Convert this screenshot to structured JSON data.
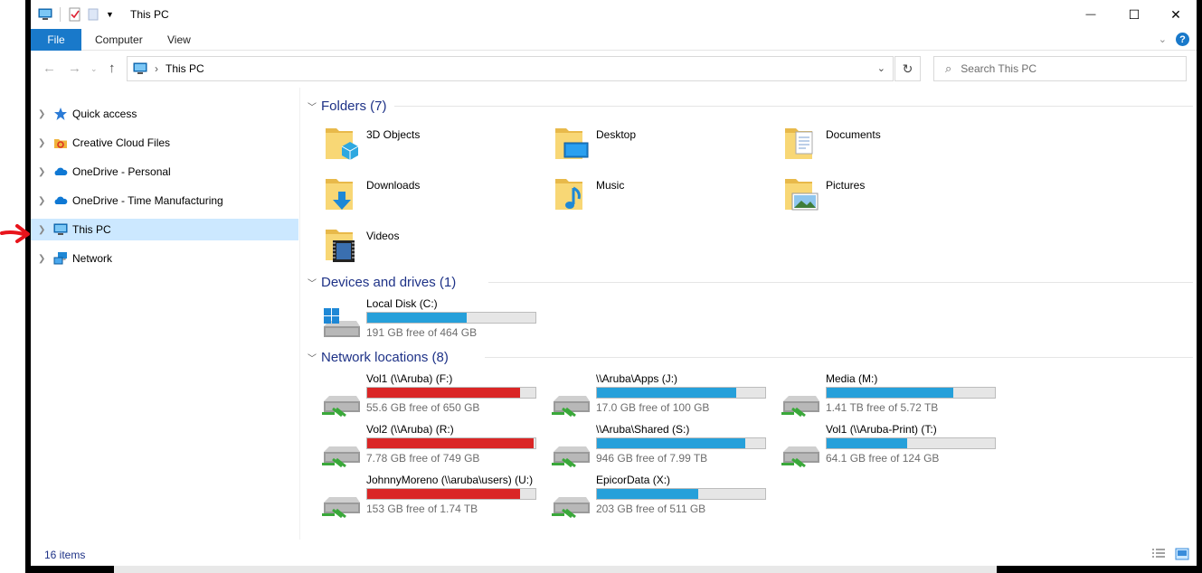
{
  "window": {
    "title": "This PC",
    "minimize": "—",
    "maximize": "☐",
    "close": "✕"
  },
  "ribbon": {
    "tabs": [
      {
        "label": "File"
      },
      {
        "label": "Computer"
      },
      {
        "label": "View"
      }
    ]
  },
  "address": {
    "breadcrumb": "This PC",
    "search_placeholder": "Search This PC"
  },
  "nav": {
    "items": [
      {
        "label": "Quick access",
        "icon": "star-icon"
      },
      {
        "label": "Creative Cloud Files",
        "icon": "creative-cloud-icon"
      },
      {
        "label": "OneDrive - Personal",
        "icon": "cloud-icon"
      },
      {
        "label": "OneDrive - Time Manufacturing",
        "icon": "cloud-icon"
      },
      {
        "label": "This PC",
        "icon": "computer-icon",
        "selected": true
      },
      {
        "label": "Network",
        "icon": "network-icon"
      }
    ]
  },
  "groups": {
    "folders": {
      "title": "Folders (7)",
      "items": [
        {
          "name": "3D Objects",
          "icon": "3d-objects-folder-icon"
        },
        {
          "name": "Desktop",
          "icon": "desktop-folder-icon"
        },
        {
          "name": "Documents",
          "icon": "documents-folder-icon"
        },
        {
          "name": "Downloads",
          "icon": "downloads-folder-icon"
        },
        {
          "name": "Music",
          "icon": "music-folder-icon"
        },
        {
          "name": "Pictures",
          "icon": "pictures-folder-icon"
        },
        {
          "name": "Videos",
          "icon": "videos-folder-icon"
        }
      ]
    },
    "devices": {
      "title": "Devices and drives (1)",
      "items": [
        {
          "name": "Local Disk (C:)",
          "free": "191 GB free of 464 GB",
          "used_fraction": 0.59,
          "critical": false
        }
      ]
    },
    "network": {
      "title": "Network locations (8)",
      "items": [
        {
          "name": "Vol1 (\\\\Aruba) (F:)",
          "free": "55.6 GB free of 650 GB",
          "used_fraction": 0.91,
          "critical": true
        },
        {
          "name": "\\\\Aruba\\Apps (J:)",
          "free": "17.0 GB free of 100 GB",
          "used_fraction": 0.83,
          "critical": false
        },
        {
          "name": "Media (M:)",
          "free": "1.41 TB free of 5.72 TB",
          "used_fraction": 0.75,
          "critical": false
        },
        {
          "name": "Vol2 (\\\\Aruba) (R:)",
          "free": "7.78 GB free of 749 GB",
          "used_fraction": 0.99,
          "critical": true
        },
        {
          "name": "\\\\Aruba\\Shared (S:)",
          "free": "946 GB free of 7.99 TB",
          "used_fraction": 0.88,
          "critical": false
        },
        {
          "name": "Vol1 (\\\\Aruba-Print) (T:)",
          "free": "64.1 GB free of 124 GB",
          "used_fraction": 0.48,
          "critical": false
        },
        {
          "name": "JohnnyMoreno (\\\\aruba\\users) (U:)",
          "free": "153 GB free of 1.74 TB",
          "used_fraction": 0.91,
          "critical": true
        },
        {
          "name": "EpicorData (X:)",
          "free": "203 GB free of 511 GB",
          "used_fraction": 0.6,
          "critical": false
        }
      ]
    }
  },
  "status": {
    "count": "16 items"
  },
  "colors": {
    "accent": "#1979ca",
    "bar_normal": "#26a0da",
    "bar_critical": "#da2626",
    "selection": "#cce8ff",
    "annotation_arrow": "#e8141b"
  }
}
